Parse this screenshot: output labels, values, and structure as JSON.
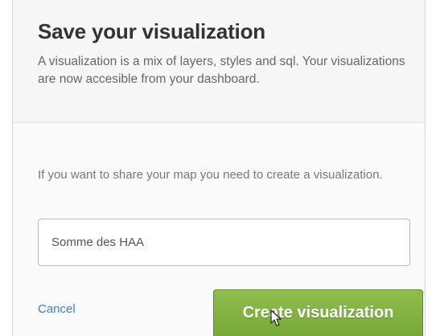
{
  "dialog": {
    "title": "Save your visualization",
    "subtitle": "A visualization is a mix of layers, styles and sql. Your visualizations are now accesible from your dashboard.",
    "body_text": "If you want to share your map you need to create a visualization.",
    "name_input": {
      "value": "Somme des HAA",
      "placeholder": ""
    },
    "cancel_label": "Cancel",
    "create_label": "Create visualization"
  },
  "colors": {
    "accent_green": "#7fb03f",
    "link_blue": "#3f7fbf",
    "title_text": "#333333"
  },
  "icons": {
    "cursor": "mouse-pointer-icon"
  }
}
